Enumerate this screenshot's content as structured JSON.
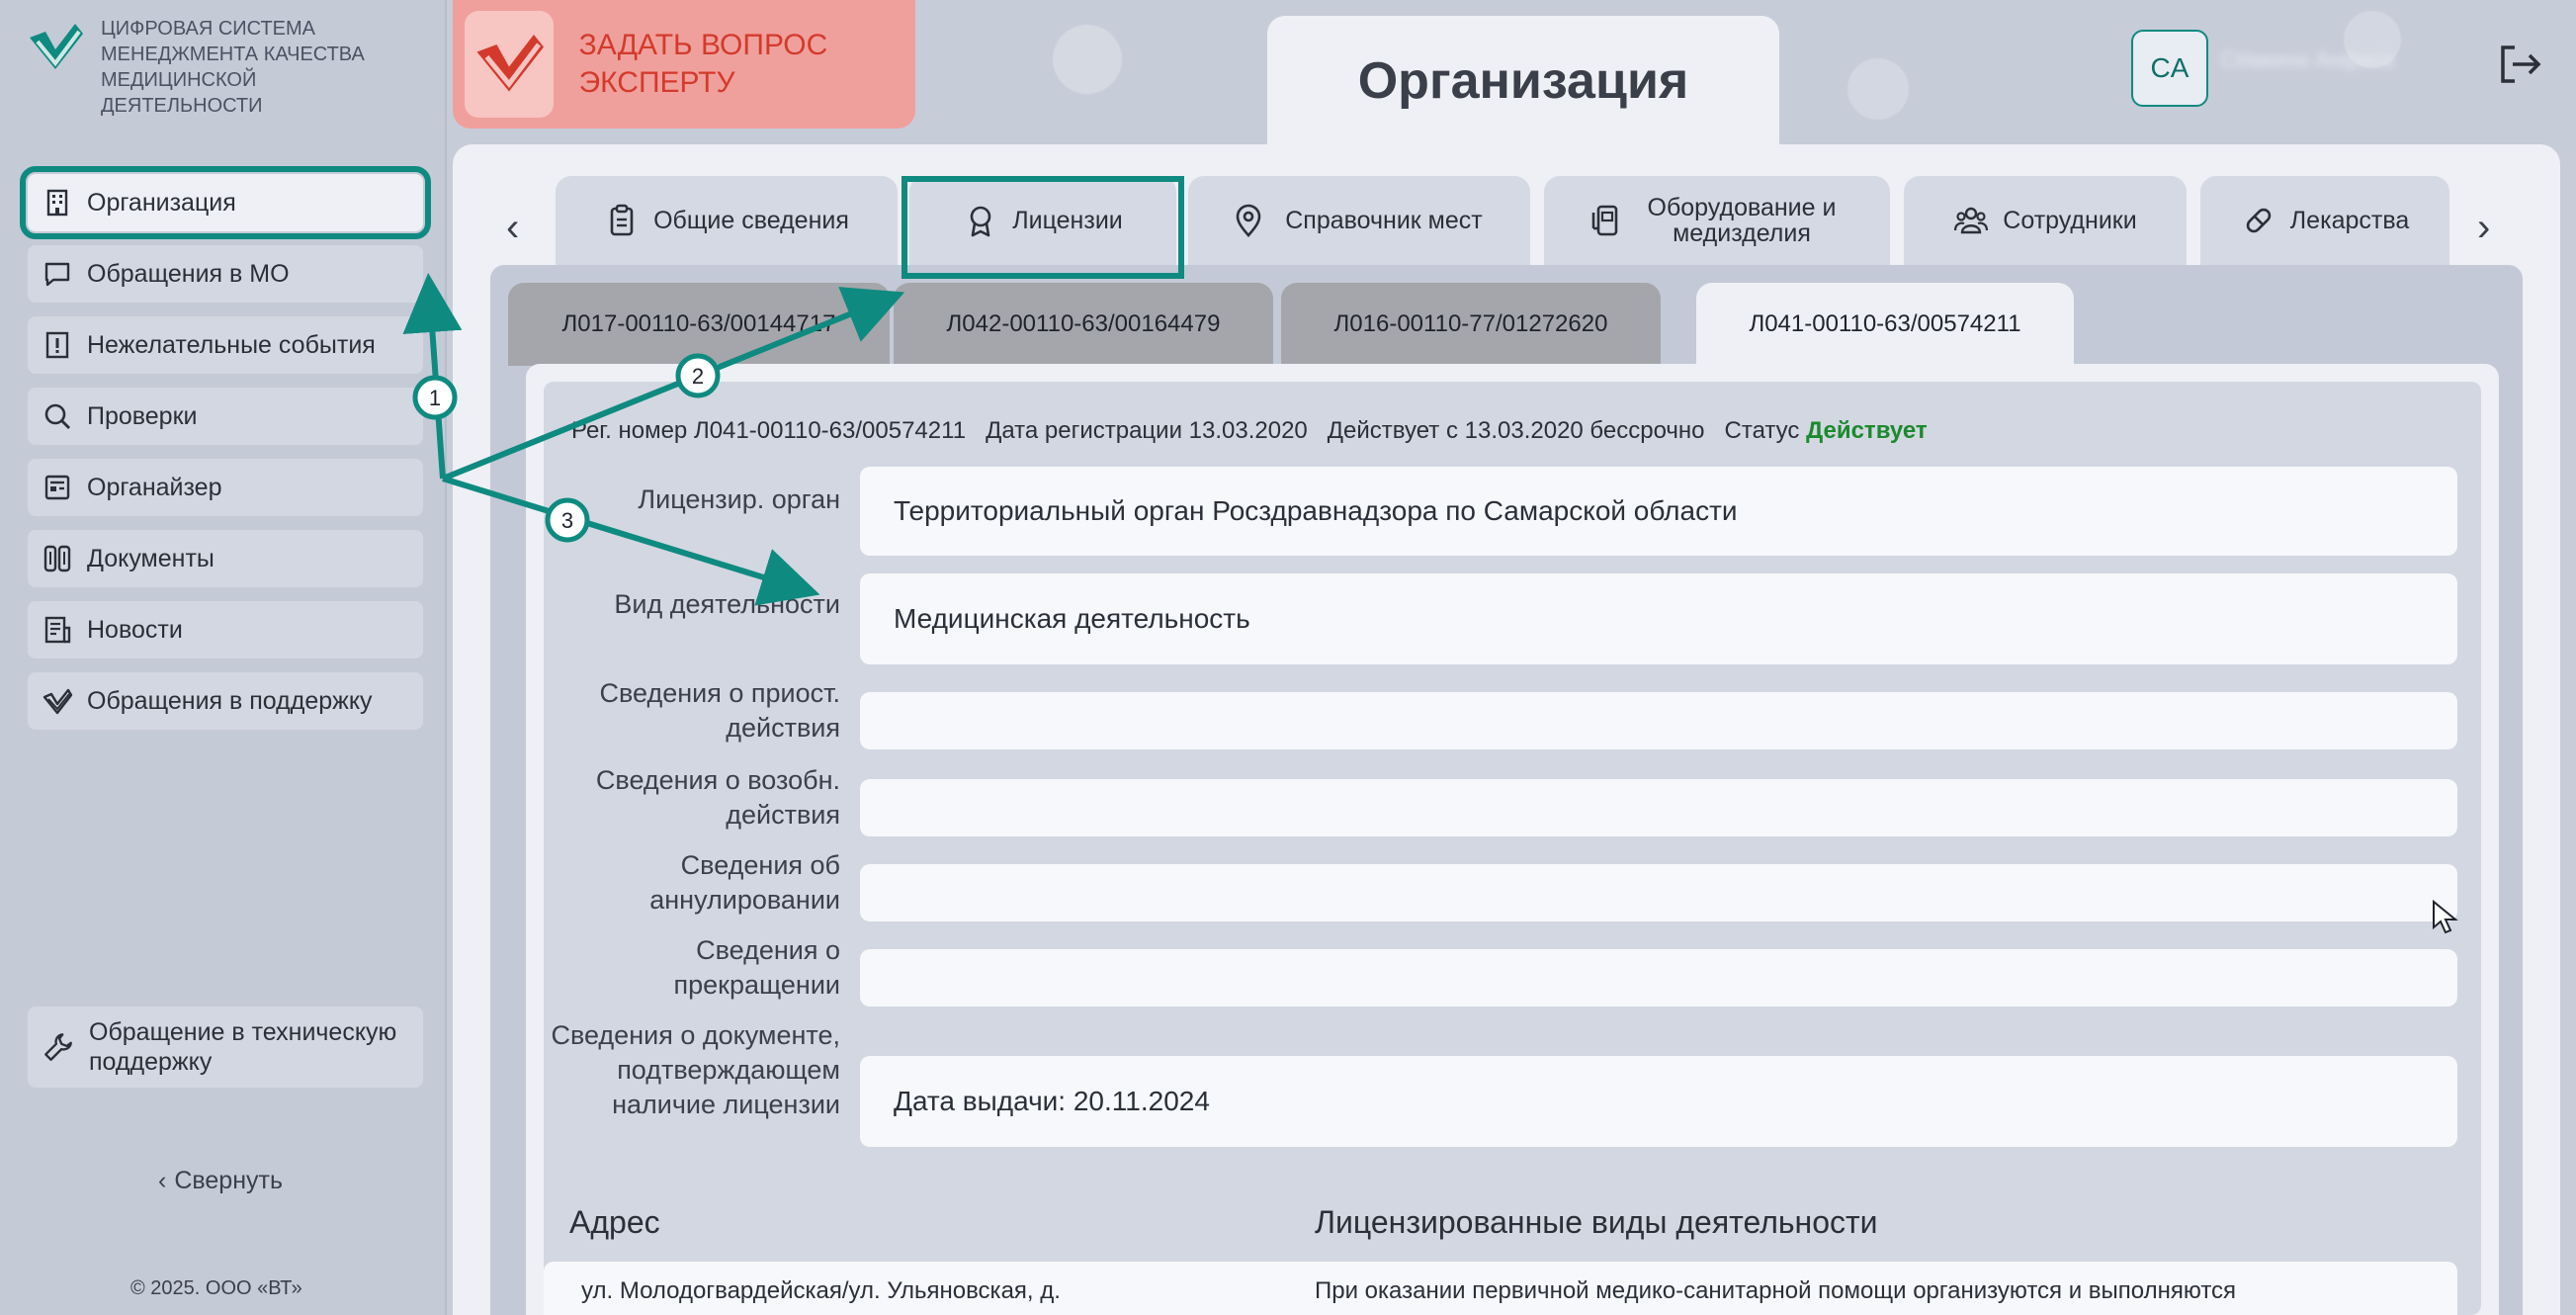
{
  "app": {
    "logo_text": "ЦИФРОВАЯ СИСТЕМА МЕНЕДЖМЕНТА КАЧЕСТВА МЕДИЦИНСКОЙ ДЕЯТЕЛЬНОСТИ",
    "brand_color": "#0f8a80"
  },
  "header": {
    "ask_expert": "ЗАДАТЬ ВОПРОС ЭКСПЕРТУ",
    "page_title": "Организация",
    "avatar_initials": "CA",
    "user_name": "Сёмкина Анфиса"
  },
  "sidebar": {
    "items": [
      {
        "label": "Организация",
        "icon": "building-icon"
      },
      {
        "label": "Обращения в МО",
        "icon": "chat-icon"
      },
      {
        "label": "Нежелательные события",
        "icon": "alert-icon"
      },
      {
        "label": "Проверки",
        "icon": "search-icon"
      },
      {
        "label": "Органайзер",
        "icon": "organizer-icon"
      },
      {
        "label": "Документы",
        "icon": "documents-icon"
      },
      {
        "label": "Новости",
        "icon": "news-icon"
      },
      {
        "label": "Обращения в поддержку",
        "icon": "support-icon"
      }
    ],
    "tech_support": "Обращение в техническую поддержку",
    "collapse": "Свернуть",
    "copyright": "© 2025. ООО «ВТ»"
  },
  "tabs": [
    {
      "label": "Общие сведения",
      "icon": "clipboard-icon"
    },
    {
      "label": "Лицензии",
      "icon": "award-icon"
    },
    {
      "label": "Справочник мест",
      "icon": "location-icon"
    },
    {
      "label": "Оборудование и медизделия",
      "icon": "device-icon"
    },
    {
      "label": "Сотрудники",
      "icon": "people-icon"
    },
    {
      "label": "Лекарства",
      "icon": "pill-icon"
    }
  ],
  "licenses": [
    "Л017-00110-63/00144717",
    "Л042-00110-63/00164479",
    "Л016-00110-77/01272620",
    "Л041-00110-63/00574211"
  ],
  "license_detail": {
    "reg_label": "Рег. номер",
    "reg_number": "Л041-00110-63/00574211",
    "reg_date_label": "Дата регистрации",
    "reg_date": "13.03.2020",
    "valid_from_label": "Действует с",
    "valid_from": "13.03.2020 бессрочно",
    "status_label": "Статус",
    "status": "Действует",
    "rows": [
      {
        "label": "Лицензир. орган",
        "value": "Территориальный орган Росздравнадзора по Самарской области"
      },
      {
        "label": "Вид деятельности",
        "value": "Медицинская деятельность"
      },
      {
        "label": "Сведения о приост. действия",
        "value": ""
      },
      {
        "label": "Сведения о возобн. действия",
        "value": ""
      },
      {
        "label": "Сведения об аннулировании",
        "value": ""
      },
      {
        "label": "Сведения о прекращении",
        "value": ""
      },
      {
        "label": "Сведения о документе, подтверждающем наличие лицензии",
        "value": "Дата выдачи: 20.11.2024"
      }
    ],
    "address_heading": "Адрес",
    "activities_heading": "Лицензированные виды деятельности",
    "address_value": "ул. Молодогвардейская/ул. Ульяновская, д.",
    "activities_value": "При оказании первичной медико-санитарной помощи организуются и выполняются"
  },
  "annotations": [
    "1",
    "2",
    "3"
  ]
}
